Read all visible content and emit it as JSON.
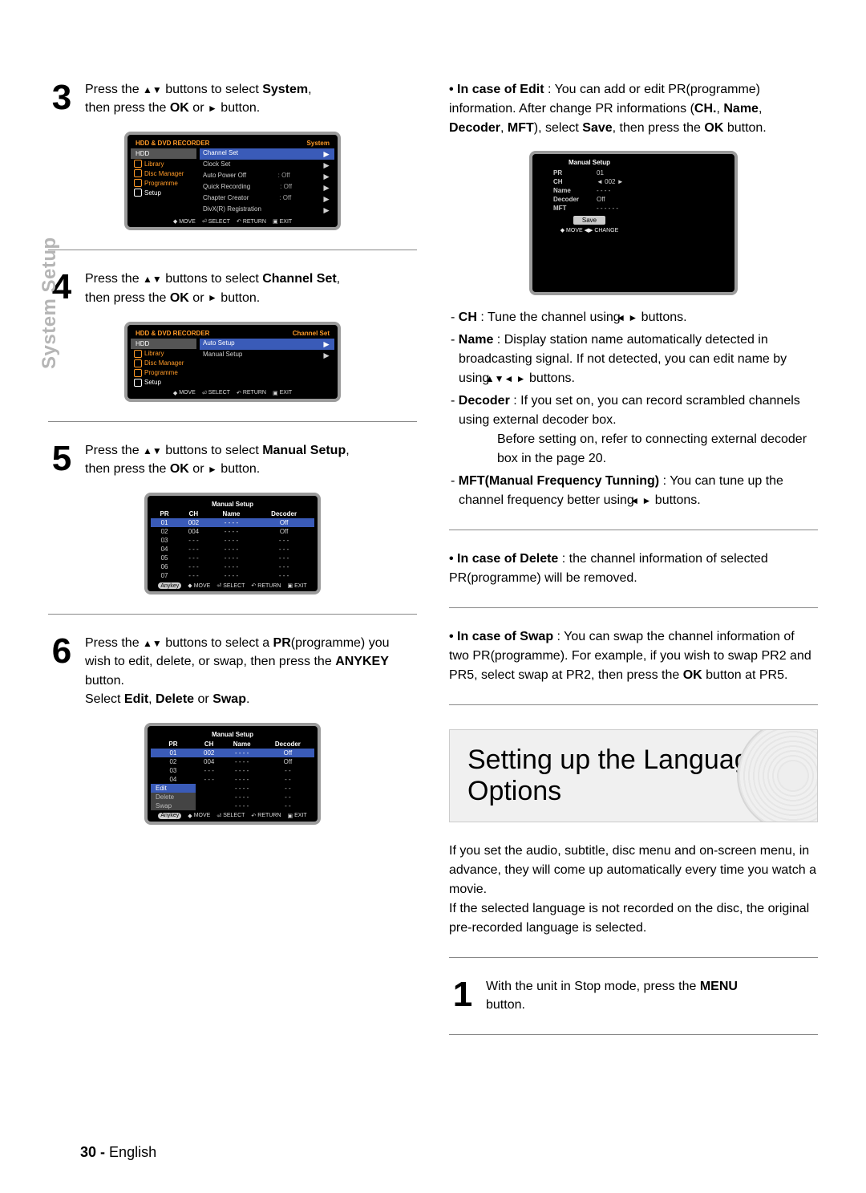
{
  "side_tab": "System Setup",
  "page_footer": {
    "num": "30 -",
    "lang": "English"
  },
  "glyph": {
    "up": "▲",
    "down": "▼",
    "left": "◄",
    "right": "►",
    "updown": "▲▼",
    "lr": "◄ ►",
    "alldir": "▲▼◄ ►"
  },
  "step3": {
    "num": "3",
    "pre": "Press the ",
    "mid1": " buttons to select ",
    "target": "System",
    "mid2": ",",
    "line2a": "then press the ",
    "ok": "OK",
    "line2b": " or ",
    "line2c": " button."
  },
  "step4": {
    "num": "4",
    "pre": "Press the ",
    "mid1": " buttons to select ",
    "target": "Channel Set",
    "mid2": ",",
    "line2a": "then press the ",
    "ok": "OK",
    "line2b": " or ",
    "line2c": " button."
  },
  "step5": {
    "num": "5",
    "pre": "Press the ",
    "mid1": " buttons to select ",
    "target": "Manual Setup",
    "mid2": ",",
    "line2a": "then press the ",
    "ok": "OK",
    "line2b": " or ",
    "line2c": " button."
  },
  "step6": {
    "num": "6",
    "l1a": "Press the ",
    "l1b": " buttons to select a ",
    "pr": "PR",
    "l1c": "(programme)",
    "l2": "you wish to edit, delete, or swap, then press the",
    "anykey": "ANYKEY",
    "l3b": " button.",
    "l4a": "Select ",
    "e": "Edit",
    "c1": ", ",
    "d": "Delete",
    "c2": " or ",
    "s": "Swap",
    "l4e": "."
  },
  "osd3": {
    "hdr_l": "HDD & DVD RECORDER",
    "hdr_r": "System",
    "tab": "HDD",
    "left_items": [
      "Library",
      "Disc Manager",
      "Programme",
      "Setup"
    ],
    "right_sel": "Channel Set",
    "right_rows": [
      [
        "Clock Set",
        ""
      ],
      [
        "Auto Power Off",
        ": Off"
      ],
      [
        "Quick Recording",
        ": Off"
      ],
      [
        "Chapter Creator",
        ": Off"
      ],
      [
        "DivX(R) Registration",
        ""
      ]
    ],
    "foot": [
      "MOVE",
      "SELECT",
      "RETURN",
      "EXIT"
    ]
  },
  "osd4": {
    "hdr_l": "HDD & DVD RECORDER",
    "hdr_r": "Channel Set",
    "tab": "HDD",
    "left_items": [
      "Library",
      "Disc Manager",
      "Programme",
      "Setup"
    ],
    "right_sel": "Auto Setup",
    "right_rows": [
      [
        "Manual Setup",
        ""
      ]
    ],
    "foot": [
      "MOVE",
      "SELECT",
      "RETURN",
      "EXIT"
    ]
  },
  "osd5": {
    "title": "Manual Setup",
    "head": [
      "PR",
      "CH",
      "Name",
      "Decoder"
    ],
    "rows": [
      [
        "01",
        "002",
        "- - - -",
        "Off"
      ],
      [
        "02",
        "004",
        "- - - -",
        "Off"
      ],
      [
        "03",
        "- - -",
        "- - - -",
        "- - -"
      ],
      [
        "04",
        "- - -",
        "- - - -",
        "- - -"
      ],
      [
        "05",
        "- - -",
        "- - - -",
        "- - -"
      ],
      [
        "06",
        "- - -",
        "- - - -",
        "- - -"
      ],
      [
        "07",
        "- - -",
        "- - - -",
        "- - -"
      ]
    ],
    "foot": [
      "MOVE",
      "SELECT",
      "RETURN",
      "EXIT"
    ],
    "anykey": "Anykey"
  },
  "osd6": {
    "title": "Manual Setup",
    "head": [
      "PR",
      "CH",
      "Name",
      "Decoder"
    ],
    "rows": [
      [
        "01",
        "002",
        "- - - -",
        "Off"
      ],
      [
        "02",
        "004",
        "- - - -",
        "Off"
      ],
      [
        "03",
        "- - -",
        "- - - -",
        "- -"
      ],
      [
        "04",
        "- - -",
        "- - - -",
        "- -"
      ]
    ],
    "ctx": [
      "Edit",
      "Delete",
      "Swap"
    ],
    "ctx_vals": [
      "- - - -",
      "- - - -",
      "- - - -"
    ],
    "ctx_r": [
      "- -",
      "- -",
      "- -"
    ],
    "foot": [
      "MOVE",
      "SELECT",
      "RETURN",
      "EXIT"
    ],
    "anykey": "Anykey"
  },
  "edit_bullets": {
    "edit_lead": "• In case of Edit",
    "edit_text": " : You can add or edit PR(programme) information. After change PR informations (",
    "edit_b1": "CH.",
    "edit_c1": ", ",
    "edit_b2": "Name",
    "edit_c2": ", ",
    "edit_b3": "Decoder",
    "edit_c3": ", ",
    "edit_b4": "MFT",
    "edit_tail": "), select ",
    "edit_b5": "Save",
    "edit_tail2": ", then press the ",
    "edit_b6": "OK",
    "edit_tail3": " button."
  },
  "osd_edit": {
    "title": "Manual Setup",
    "kv": [
      [
        "PR",
        "01"
      ],
      [
        "CH",
        "◄   002   ►"
      ],
      [
        "Name",
        "- - - -"
      ],
      [
        "Decoder",
        "Off"
      ],
      [
        "MFT",
        "- - -  - - -"
      ]
    ],
    "btn": "Save",
    "barfoot": "◆ MOVE   ◀▶  CHANGE"
  },
  "defs": {
    "ch_b": "CH",
    "ch_t": " : Tune the channel using ",
    "ch_t2": " buttons.",
    "name_b": "Name",
    "name_t": " : Display station name automatically detected in broadcasting signal. If not detected, you can edit name by using ",
    "name_t2": " buttons.",
    "dec_b": "Decoder",
    "dec_t": " : If you set on, you can record scrambled channels using external decoder box.",
    "dec_t2": "Before setting on, refer to connecting external decoder box in the page 20.",
    "mft_b": "MFT(Manual Frequency Tunning)",
    "mft_t": " : You can tune up the channel frequency better using ",
    "mft_t2": " buttons."
  },
  "del": {
    "lead": "• In case of Delete",
    "text": " : the channel information of selected PR(programme) will be removed."
  },
  "swap": {
    "lead": "• In case of Swap",
    "t1": " : You can swap the channel information of two PR(programme). For example, if you wish to swap PR2 and PR5, select swap at PR2, then press the ",
    "b": "OK",
    "t2": " button at PR5."
  },
  "lang_section": {
    "title_l1": "Setting up the Language",
    "title_l2": "Options",
    "p1": "If you set the audio, subtitle, disc menu and on-screen menu, in advance, they will come up automatically every time you watch a movie.",
    "p2": "If the selected language is not recorded on the disc, the original pre-recorded language is selected."
  },
  "lang_step1": {
    "num": "1",
    "a": "With the unit in Stop mode, press the ",
    "b": "MENU",
    "c": " button."
  }
}
